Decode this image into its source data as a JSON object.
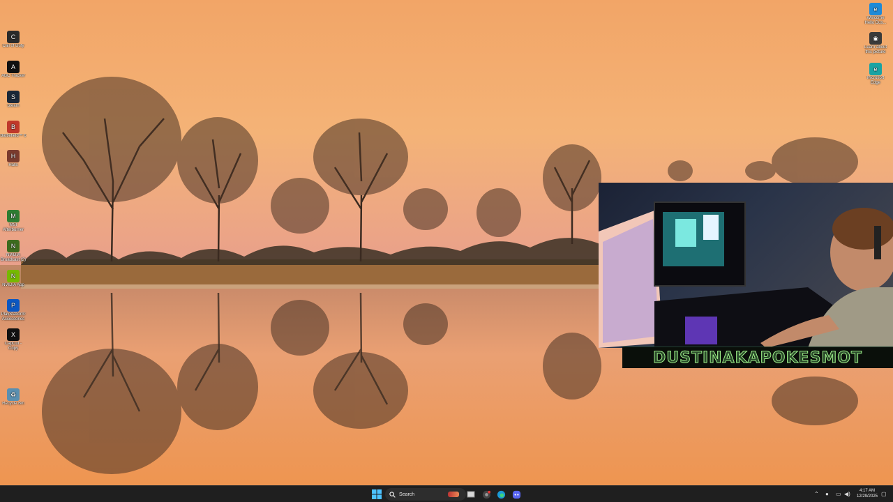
{
  "desktop_left": [
    {
      "name": "call-of-duty",
      "label": "Call of Duty",
      "color": "#2b2b2b",
      "glyph": "C"
    },
    {
      "name": "abc-tracker",
      "label": "ABC Tracker",
      "color": "#111111",
      "glyph": "A"
    },
    {
      "name": "steam",
      "label": "Steam",
      "color": "#1b2838",
      "glyph": "S"
    },
    {
      "name": "battlefield",
      "label": "Battlefield™ 6",
      "color": "#c0392b",
      "glyph": "B"
    },
    {
      "name": "halls",
      "label": "Halls",
      "color": "#7a3b2e",
      "glyph": "H"
    },
    {
      "name": "msi-afterburner",
      "label": "MSI Afterburner",
      "color": "#2e7d32",
      "glyph": "M"
    },
    {
      "name": "nvidia-broadcast",
      "label": "NVIDIA Broadcast (2)",
      "color": "#3d6b1e",
      "glyph": "N"
    },
    {
      "name": "nvidia-app",
      "label": "NVIDIA App",
      "color": "#76b900",
      "glyph": "N"
    },
    {
      "name": "playstation-accessories",
      "label": "PlayStation® Accessories",
      "color": "#0b57c2",
      "glyph": "P"
    },
    {
      "name": "capcut",
      "label": "CapCut - Copy",
      "color": "#111111",
      "glyph": "X"
    },
    {
      "name": "recycle-bin",
      "label": "Recycle Bin",
      "color": "#5a8fb0",
      "glyph": "♻"
    }
  ],
  "desktop_right": [
    {
      "name": "welcome-edge",
      "label": "Welcome Hello Dus...",
      "color": "#1f8ad6",
      "glyph": "e"
    },
    {
      "name": "learn-about-picture",
      "label": "Learn about this picture",
      "color": "#3a3a3a",
      "glyph": "◉"
    },
    {
      "name": "microsoft-edge",
      "label": "Microsoft Edge",
      "color": "#1aa3a3",
      "glyph": "e"
    }
  ],
  "webcam": {
    "name": "DUSTINAKAPOKESMOT"
  },
  "taskbar": {
    "search_label": "Search",
    "time": "4:17 AM",
    "date": "12/29/2025"
  }
}
